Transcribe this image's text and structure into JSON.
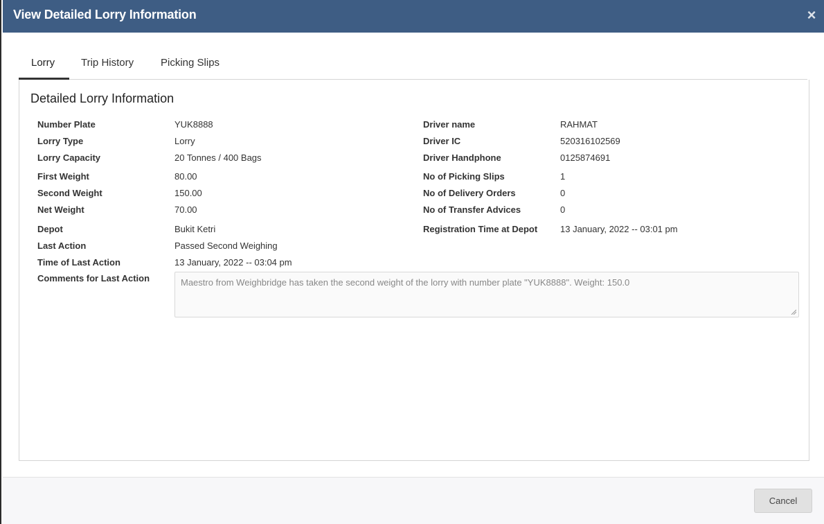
{
  "modal": {
    "title": "View Detailed Lorry Information",
    "close_icon": "×"
  },
  "tabs": [
    {
      "label": "Lorry",
      "active": true
    },
    {
      "label": "Trip History",
      "active": false
    },
    {
      "label": "Picking Slips",
      "active": false
    }
  ],
  "panel": {
    "title": "Detailed Lorry Information"
  },
  "left_fields": [
    {
      "label": "Number Plate",
      "value": "YUK8888"
    },
    {
      "label": "Lorry Type",
      "value": "Lorry"
    },
    {
      "label": "Lorry Capacity",
      "value": "20 Tonnes / 400 Bags"
    },
    {
      "label": "First Weight",
      "value": "80.00"
    },
    {
      "label": "Second Weight",
      "value": "150.00"
    },
    {
      "label": "Net Weight",
      "value": "70.00"
    },
    {
      "label": "Depot",
      "value": "Bukit Ketri"
    },
    {
      "label": "Last Action",
      "value": "Passed Second Weighing"
    },
    {
      "label": "Time of Last Action",
      "value": "13 January, 2022 -- 03:04 pm"
    },
    {
      "label": "Comments for Last Action"
    }
  ],
  "right_fields": [
    {
      "label": "Driver name",
      "value": "RAHMAT"
    },
    {
      "label": "Driver IC",
      "value": "520316102569"
    },
    {
      "label": "Driver Handphone",
      "value": "0125874691"
    },
    {
      "label": "No of Picking Slips",
      "value": "1"
    },
    {
      "label": "No of Delivery Orders",
      "value": "0"
    },
    {
      "label": "No of Transfer Advices",
      "value": "0"
    },
    {
      "label": "Registration Time at Depot",
      "value": "13 January, 2022 -- 03:01 pm"
    }
  ],
  "comment": "Maestro  from Weighbridge has taken the second weight of the lorry with number plate \"YUK8888\".  Weight: 150.0",
  "footer": {
    "cancel_label": "Cancel"
  },
  "colors": {
    "header_bg": "#3e5d84",
    "header_text": "#ffffff",
    "cancel_bg": "#e1e1e1"
  }
}
